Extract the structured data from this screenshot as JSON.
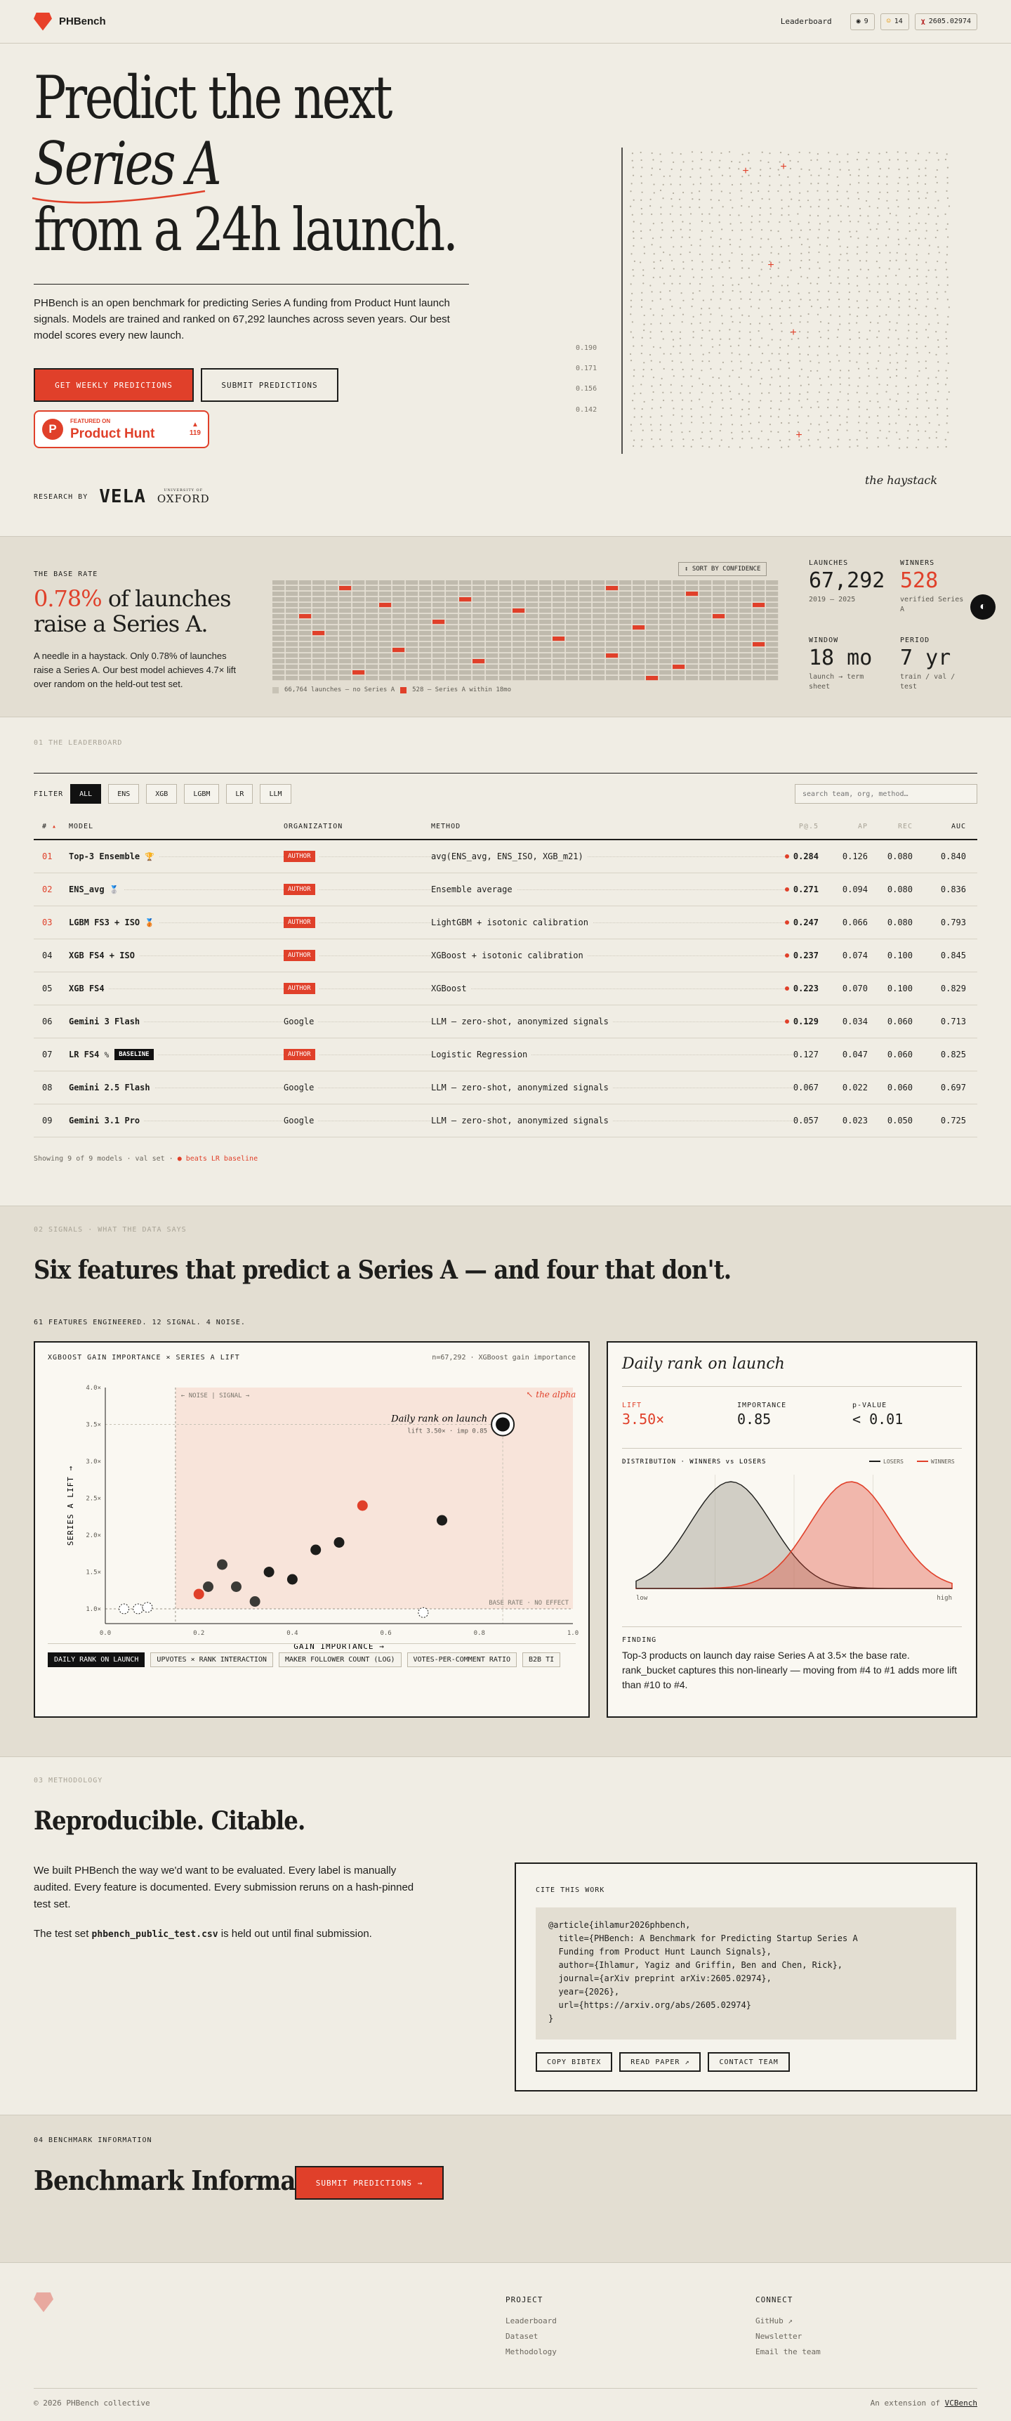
{
  "nav": {
    "brand": "PHBench",
    "leaderboard": "Leaderboard",
    "github_count": "9",
    "hf_count": "14",
    "arxiv": "2605.02974"
  },
  "hero": {
    "title_line1": "Predict the next",
    "title_line2": "Series A",
    "title_line3": "from a 24h launch.",
    "intro": "PHBench is an open benchmark for predicting Series A funding from Product Hunt launch signals. Models are trained and ranked on 67,292 launches across seven years. Our best model scores every new launch.",
    "cta_primary": "GET WEEKLY PREDICTIONS",
    "cta_secondary": "SUBMIT PREDICTIONS",
    "ph_featured": "FEATURED ON",
    "ph_name": "Product Hunt",
    "ph_votes": "119",
    "research_by": "RESEARCH BY",
    "vela": "VELA",
    "oxford_small": "UNIVERSITY OF",
    "oxford": "OXFORD",
    "haystack_caption": "the haystack",
    "haystack_ticks": [
      "0.190",
      "0.171",
      "0.156",
      "0.142"
    ]
  },
  "base_rate": {
    "label": "THE BASE RATE",
    "pct": "0.78%",
    "line1_rest": " of launches",
    "line2": "raise a Series A.",
    "text": "A needle in a haystack. Only 0.78% of launches raise a Series A. Our best model achieves 4.7× lift over random on the held-out test set.",
    "sort": "↕ SORT BY CONFIDENCE",
    "legend_neg": "66,764 launches — no Series A",
    "legend_pos": "528 — Series A within 18mo",
    "stats": [
      {
        "label": "LAUNCHES",
        "value": "67,292",
        "sub": "2019 — 2025"
      },
      {
        "label": "WINNERS",
        "value": "528",
        "sub": "verified Series A"
      },
      {
        "label": "WINDOW",
        "value": "18 mo",
        "sub": "launch → term sheet"
      },
      {
        "label": "PERIOD",
        "value": "7 yr",
        "sub": "train / val / test"
      }
    ],
    "mode_icon": "◐"
  },
  "leaderboard": {
    "label": "01  THE LEADERBOARD",
    "filter_label": "FILTER",
    "filters": [
      "ALL",
      "ENS",
      "XGB",
      "LGBM",
      "LR",
      "LLM"
    ],
    "search_placeholder": "search team, org, method…",
    "headers": [
      "#",
      "MODEL",
      "ORGANIZATION",
      "METHOD",
      "P@.5",
      "AP",
      "REC",
      "AUC"
    ],
    "rows": [
      {
        "rank": "01",
        "model": "Top-3 Ensemble",
        "badge": "🏆",
        "org": "AUTHOR",
        "method": "avg(ENS_avg, ENS_ISO, XGB_m21)",
        "p": "0.284",
        "ap": "0.126",
        "rec": "0.080",
        "auc": "0.840"
      },
      {
        "rank": "02",
        "model": "ENS_avg",
        "badge": "🥈",
        "org": "AUTHOR",
        "method": "Ensemble average",
        "p": "0.271",
        "ap": "0.094",
        "rec": "0.080",
        "auc": "0.836"
      },
      {
        "rank": "03",
        "model": "LGBM FS3 + ISO",
        "badge": "🥉",
        "org": "AUTHOR",
        "method": "LightGBM + isotonic calibration",
        "p": "0.247",
        "ap": "0.066",
        "rec": "0.080",
        "auc": "0.793"
      },
      {
        "rank": "04",
        "model": "XGB FS4 + ISO",
        "badge": "",
        "org": "AUTHOR",
        "method": "XGBoost + isotonic calibration",
        "p": "0.237",
        "ap": "0.074",
        "rec": "0.100",
        "auc": "0.845"
      },
      {
        "rank": "05",
        "model": "XGB FS4",
        "badge": "",
        "org": "AUTHOR",
        "method": "XGBoost",
        "p": "0.223",
        "ap": "0.070",
        "rec": "0.100",
        "auc": "0.829"
      },
      {
        "rank": "06",
        "model": "Gemini 3 Flash",
        "badge": "",
        "org": "Google",
        "method": "LLM — zero-shot, anonymized signals",
        "p": "0.129",
        "ap": "0.034",
        "rec": "0.060",
        "auc": "0.713"
      },
      {
        "rank": "07",
        "model": "LR FS4",
        "badge": "%",
        "baseline": "BASELINE",
        "org": "AUTHOR",
        "method": "Logistic Regression",
        "p": "0.127",
        "ap": "0.047",
        "rec": "0.060",
        "auc": "0.825"
      },
      {
        "rank": "08",
        "model": "Gemini 2.5 Flash",
        "badge": "",
        "org": "Google",
        "method": "LLM — zero-shot, anonymized signals",
        "p": "0.067",
        "ap": "0.022",
        "rec": "0.060",
        "auc": "0.697"
      },
      {
        "rank": "09",
        "model": "Gemini 3.1 Pro",
        "badge": "",
        "org": "Google",
        "method": "LLM — zero-shot, anonymized signals",
        "p": "0.057",
        "ap": "0.023",
        "rec": "0.050",
        "auc": "0.725"
      }
    ],
    "footer": "Showing 9 of 9 models · val set · ",
    "footer_red": "● beats LR baseline"
  },
  "signals": {
    "label": "02  SIGNALS · WHAT THE DATA SAYS",
    "heading": "Six features that predict a Series A — and four that don't.",
    "sub": "61 FEATURES ENGINEERED. 12 SIGNAL. 4 NOISE.",
    "card1_title": "XGBOOST GAIN IMPORTANCE × SERIES A LIFT",
    "card1_note": "n=67,292 · XGBoost gain importance",
    "chips": [
      "DAILY RANK ON LAUNCH",
      "UPVOTES × RANK INTERACTION",
      "MAKER FOLLOWER COUNT (LOG)",
      "VOTES-PER-COMMENT RATIO",
      "B2B TI"
    ],
    "card2": {
      "title": "Daily rank on launch",
      "stats": [
        {
          "label": "LIFT",
          "value": "3.50×"
        },
        {
          "label": "IMPORTANCE",
          "value": "0.85"
        },
        {
          "label": "p-VALUE",
          "value": "< 0.01"
        }
      ],
      "dist_label": "DISTRIBUTION · WINNERS vs LOSERS",
      "legend_losers": "LOSERS",
      "legend_winners": "WINNERS",
      "axis_low": "low",
      "axis_high": "high",
      "finding_label": "FINDING",
      "finding": "Top-3 products on launch day raise Series A at 3.5× the base rate. rank_bucket captures this non-linearly — moving from #4 to #1 adds more lift than #10 to #4."
    }
  },
  "chart_data": {
    "type": "scatter",
    "title": "",
    "xlabel": "GAIN IMPORTANCE →",
    "ylabel": "SERIES A LIFT →",
    "xlim": [
      0,
      1
    ],
    "ylim": [
      0.8,
      4.0
    ],
    "x_ticks": [
      "0.0",
      "0.2",
      "0.4",
      "0.6",
      "0.8",
      "1.0"
    ],
    "y_ticks": [
      "1.0×",
      "1.5×",
      "2.0×",
      "2.5×",
      "3.0×",
      "3.5×",
      "4.0×"
    ],
    "annotations": [
      "← NOISE | SIGNAL →",
      "Daily rank on launch",
      "lift 3.50× · imp 0.85",
      "↖ the alpha",
      "BASE RATE · NO EFFECT"
    ],
    "points": [
      {
        "x": 0.85,
        "y": 3.5,
        "kind": "highlight"
      },
      {
        "x": 0.55,
        "y": 2.4,
        "kind": "signal-red"
      },
      {
        "x": 0.72,
        "y": 2.2,
        "kind": "signal"
      },
      {
        "x": 0.5,
        "y": 1.9,
        "kind": "signal"
      },
      {
        "x": 0.45,
        "y": 1.8,
        "kind": "signal"
      },
      {
        "x": 0.35,
        "y": 1.5,
        "kind": "signal"
      },
      {
        "x": 0.25,
        "y": 1.6,
        "kind": "signal"
      },
      {
        "x": 0.4,
        "y": 1.4,
        "kind": "signal"
      },
      {
        "x": 0.28,
        "y": 1.3,
        "kind": "signal"
      },
      {
        "x": 0.22,
        "y": 1.3,
        "kind": "signal"
      },
      {
        "x": 0.32,
        "y": 1.1,
        "kind": "signal"
      },
      {
        "x": 0.2,
        "y": 1.2,
        "kind": "signal-red"
      },
      {
        "x": 0.04,
        "y": 1.0,
        "kind": "noise"
      },
      {
        "x": 0.07,
        "y": 1.0,
        "kind": "noise"
      },
      {
        "x": 0.09,
        "y": 1.02,
        "kind": "noise"
      },
      {
        "x": 0.68,
        "y": 0.95,
        "kind": "noise"
      }
    ],
    "distribution": {
      "losers_peak": 0.3,
      "winners_peak": 0.68
    }
  },
  "methodology": {
    "label": "03  METHODOLOGY",
    "heading": "Reproducible. Citable.",
    "p1": "We built PHBench the way we'd want to be evaluated. Every label is manually audited. Every feature is documented. Every submission reruns on a hash-pinned test set.",
    "p2_pre": "The test set ",
    "p2_code": "phbench_public_test.csv",
    "p2_post": " is held out until final submission.",
    "cite_label": "CITE THIS WORK",
    "bibtex": "@article{ihlamur2026phbench,\n  title={PHBench: A Benchmark for Predicting Startup Series A\n  Funding from Product Hunt Launch Signals},\n  author={Ihlamur, Yagiz and Griffin, Ben and Chen, Rick},\n  journal={arXiv preprint arXiv:2605.02974},\n  year={2026},\n  url={https://arxiv.org/abs/2605.02974}\n}",
    "btn_copy": "COPY BIBTEX",
    "btn_read": "READ PAPER ↗",
    "btn_contact": "CONTACT TEAM"
  },
  "bench": {
    "label": "04  BENCHMARK INFORMATION",
    "heading": "Benchmark Information",
    "btn": "SUBMIT PREDICTIONS →"
  },
  "footer": {
    "project_h": "PROJECT",
    "project": [
      "Leaderboard",
      "Dataset",
      "Methodology"
    ],
    "connect_h": "CONNECT",
    "connect": [
      "GitHub ↗",
      "Newsletter",
      "Email the team"
    ],
    "copyright": "© 2026 PHBench collective",
    "ext_pre": "An extension of ",
    "ext_link": "VCBench"
  },
  "colors": {
    "accent": "#e0402a",
    "ink": "#1d1d1b",
    "paper": "#f0ede4",
    "band": "#e3ded2"
  }
}
